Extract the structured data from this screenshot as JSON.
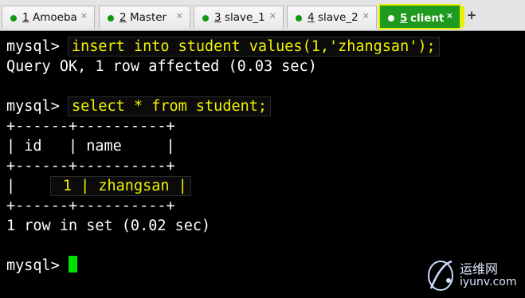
{
  "tabs": [
    {
      "num": "1",
      "label": "Amoeba"
    },
    {
      "num": "2",
      "label": "Master"
    },
    {
      "num": "3",
      "label": "slave_1"
    },
    {
      "num": "4",
      "label": "slave_2"
    },
    {
      "num": "5",
      "label": "client"
    }
  ],
  "active_tab": 4,
  "tab_close_glyph": "×",
  "tab_add_glyph": "+",
  "terminal": {
    "prompt": "mysql> ",
    "cmd1": "insert into student values(1,'zhangsan');",
    "result1": "Query OK, 1 row affected (0.03 sec)",
    "cmd2": "select * from student;",
    "table_border": "+------+----------+",
    "table_header": "| id   | name     |",
    "row_left": "|    ",
    "row_value": " 1 | zhangsan |",
    "result2": "1 row in set (0.02 sec)"
  },
  "watermark": {
    "line1": "运维网",
    "line2": "iyunv.com"
  },
  "colors": {
    "highlight_text": "#f2f200",
    "active_tab_bg": "#1e9a1e",
    "cursor": "#00e000"
  }
}
